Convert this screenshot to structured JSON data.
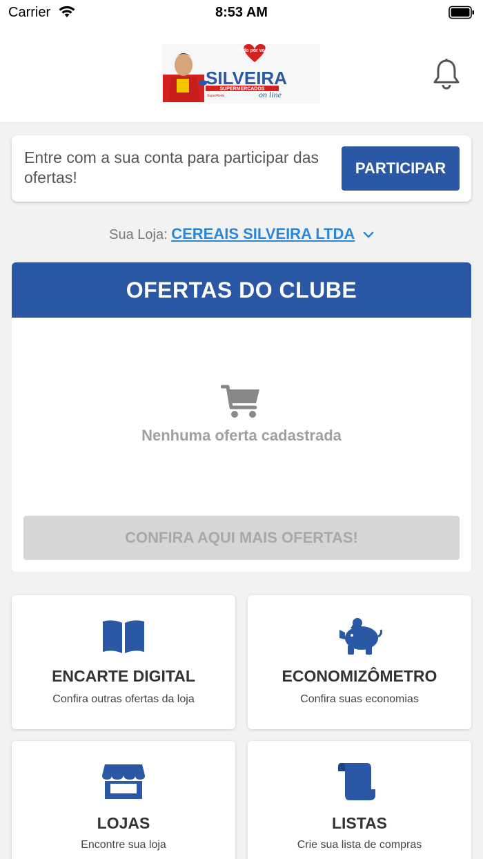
{
  "status_bar": {
    "carrier": "Carrier",
    "time": "8:53 AM"
  },
  "header": {
    "logo": {
      "brand": "SILVEIRA",
      "tagline": "SUPERMERCADOS",
      "badge": "Tudo por você!",
      "online": "on line",
      "network": "SuperRede"
    },
    "icons": {
      "notifications": "bell-icon"
    }
  },
  "login_card": {
    "text": "Entre com a sua conta para participar das ofertas!",
    "button_label": "PARTICIPAR"
  },
  "store_selector": {
    "prefix": "Sua Loja:",
    "store_name": "CEREAIS SILVEIRA LTDA"
  },
  "offers": {
    "title": "OFERTAS DO CLUBE",
    "empty_message": "Nenhuma oferta cadastrada",
    "more_button": "CONFIRA AQUI MAIS OFERTAS!"
  },
  "tiles": [
    {
      "title": "ENCARTE DIGITAL",
      "subtitle": "Confira outras ofertas da loja",
      "icon": "book-icon"
    },
    {
      "title": "ECONOMIZÔMETRO",
      "subtitle": "Confira suas economias",
      "icon": "piggy-bank-icon"
    },
    {
      "title": "LOJAS",
      "subtitle": "Encontre sua loja",
      "icon": "store-icon"
    },
    {
      "title": "LISTAS",
      "subtitle": "Crie sua lista de compras",
      "icon": "scroll-icon"
    }
  ],
  "colors": {
    "primary": "#2a58a4",
    "link": "#2a86d8",
    "background": "#f2f2f2",
    "disabled": "#d6d6d6"
  }
}
